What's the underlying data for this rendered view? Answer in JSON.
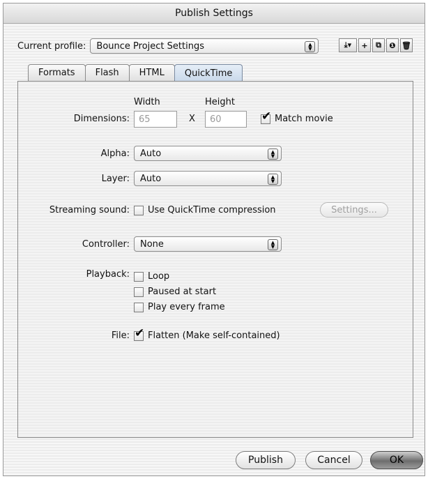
{
  "window": {
    "title": "Publish Settings"
  },
  "profile": {
    "label": "Current profile:",
    "value": "Bounce Project Settings"
  },
  "toolbar": {
    "icons": [
      "import-export-icon",
      "add-profile-icon",
      "duplicate-icon",
      "info-icon",
      "trash-icon"
    ]
  },
  "tabs": [
    {
      "label": "Formats",
      "active": false
    },
    {
      "label": "Flash",
      "active": false
    },
    {
      "label": "HTML",
      "active": false
    },
    {
      "label": "QuickTime",
      "active": true
    }
  ],
  "dimensions": {
    "label": "Dimensions:",
    "width_header": "Width",
    "height_header": "Height",
    "width_value": "65",
    "separator": "X",
    "height_value": "60",
    "match_movie_label": "Match movie",
    "match_movie_checked": true
  },
  "alpha": {
    "label": "Alpha:",
    "value": "Auto"
  },
  "layer": {
    "label": "Layer:",
    "value": "Auto"
  },
  "streaming": {
    "label": "Streaming sound:",
    "checkbox_label": "Use QuickTime compression",
    "checked": false,
    "settings_button": "Settings..."
  },
  "controller": {
    "label": "Controller:",
    "value": "None"
  },
  "playback": {
    "label": "Playback:",
    "options": [
      {
        "label": "Loop",
        "checked": false
      },
      {
        "label": "Paused at start",
        "checked": false
      },
      {
        "label": "Play every frame",
        "checked": false
      }
    ]
  },
  "file": {
    "label": "File:",
    "checkbox_label": "Flatten (Make self-contained)",
    "checked": true
  },
  "buttons": {
    "publish": "Publish",
    "cancel": "Cancel",
    "ok": "OK"
  }
}
